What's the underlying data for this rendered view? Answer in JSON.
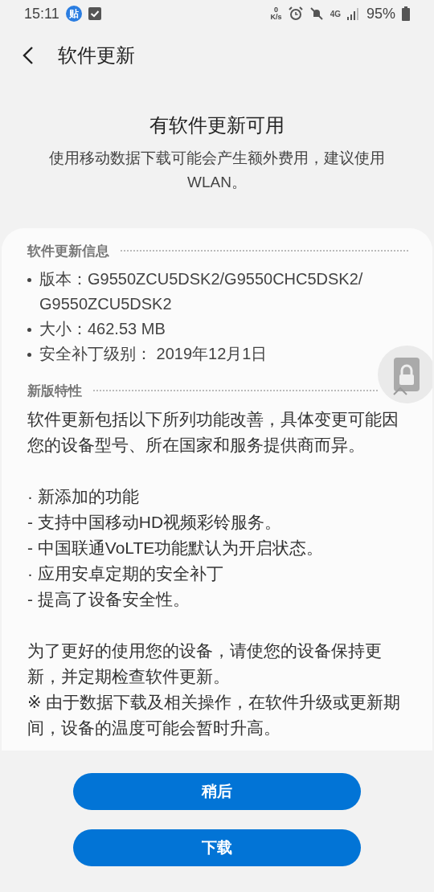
{
  "status_bar": {
    "time": "15:11",
    "notification_badge": "贴",
    "net_speed": "0",
    "net_unit": "K/s",
    "network": "4G",
    "battery": "95%"
  },
  "header": {
    "title": "软件更新"
  },
  "intro": {
    "title": "有软件更新可用",
    "message": "使用移动数据下载可能会产生额外费用，建议使用 WLAN。"
  },
  "info_section": {
    "heading": "软件更新信息",
    "items": [
      {
        "label": "版本：",
        "value_lines": [
          "G9550ZCU5DSK2/G9550CHC5DSK2/",
          "G9550ZCU5DSK2"
        ]
      },
      {
        "label": "大小：",
        "value": "462.53 MB"
      },
      {
        "label": "安全补丁级别：",
        "value": " 2019年12月1日"
      }
    ]
  },
  "features_section": {
    "heading": "新版特性",
    "expanded": true,
    "paragraphs": [
      [
        "软件更新包括以下所列功能改善，具体变更可能因您的设备型号、所在国家和服务提供商而异。"
      ],
      [
        "· 新添加的功能",
        "- 支持中国移动HD视频彩铃服务。",
        "- 中国联通VoLTE功能默认为开启状态。",
        "· 应用安卓定期的安全补丁",
        "- 提高了设备安全性。"
      ],
      [
        "为了更好的使用您的设备，请使您的设备保持更新，并定期检查软件更新。",
        "※ 由于数据下载及相关操作，在软件升级或更新期间，设备的温度可能会暂时升高。"
      ]
    ]
  },
  "buttons": [
    {
      "label": "稍后"
    },
    {
      "label": "下载"
    }
  ]
}
